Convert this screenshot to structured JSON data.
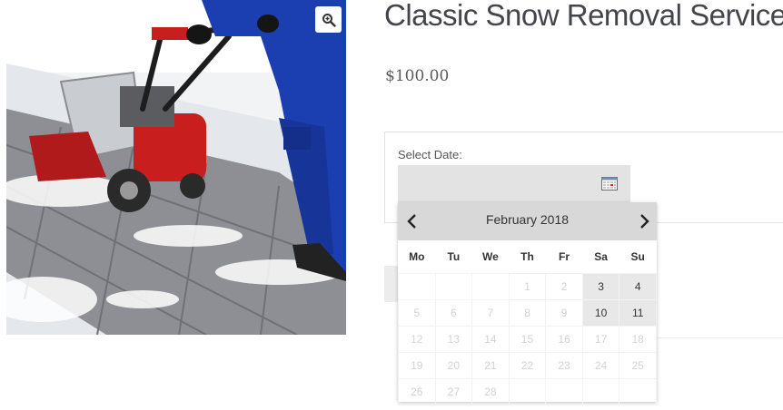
{
  "product": {
    "title": "Classic Snow Removal Service",
    "price": "$100.00"
  },
  "image": {
    "zoom_icon": "magnifier-plus-icon",
    "description_icon": "snow-blower-photo"
  },
  "booking": {
    "date_label": "Select Date:",
    "date_value": "",
    "calendar_icon": "calendar-icon"
  },
  "datepicker": {
    "month_label": "February 2018",
    "prev_icon": "chevron-left-icon",
    "next_icon": "chevron-right-icon",
    "weekdays": [
      "Mo",
      "Tu",
      "We",
      "Th",
      "Fr",
      "Sa",
      "Su"
    ],
    "weeks": [
      [
        {
          "day": "",
          "state": "empty"
        },
        {
          "day": "",
          "state": "empty"
        },
        {
          "day": "",
          "state": "empty"
        },
        {
          "day": "1",
          "state": "disabled"
        },
        {
          "day": "2",
          "state": "disabled"
        },
        {
          "day": "3",
          "state": "available"
        },
        {
          "day": "4",
          "state": "available"
        }
      ],
      [
        {
          "day": "5",
          "state": "disabled"
        },
        {
          "day": "6",
          "state": "disabled"
        },
        {
          "day": "7",
          "state": "disabled"
        },
        {
          "day": "8",
          "state": "disabled"
        },
        {
          "day": "9",
          "state": "disabled"
        },
        {
          "day": "10",
          "state": "available"
        },
        {
          "day": "11",
          "state": "available"
        }
      ],
      [
        {
          "day": "12",
          "state": "disabled"
        },
        {
          "day": "13",
          "state": "disabled"
        },
        {
          "day": "14",
          "state": "disabled"
        },
        {
          "day": "15",
          "state": "disabled"
        },
        {
          "day": "16",
          "state": "disabled"
        },
        {
          "day": "17",
          "state": "disabled"
        },
        {
          "day": "18",
          "state": "disabled"
        }
      ],
      [
        {
          "day": "19",
          "state": "disabled"
        },
        {
          "day": "20",
          "state": "disabled"
        },
        {
          "day": "21",
          "state": "disabled"
        },
        {
          "day": "22",
          "state": "disabled"
        },
        {
          "day": "23",
          "state": "disabled"
        },
        {
          "day": "24",
          "state": "disabled"
        },
        {
          "day": "25",
          "state": "disabled"
        }
      ],
      [
        {
          "day": "26",
          "state": "disabled"
        },
        {
          "day": "27",
          "state": "disabled"
        },
        {
          "day": "28",
          "state": "disabled"
        },
        {
          "day": "",
          "state": "empty"
        },
        {
          "day": "",
          "state": "empty"
        },
        {
          "day": "",
          "state": "empty"
        },
        {
          "day": "",
          "state": "empty"
        }
      ]
    ]
  },
  "colors": {
    "header_bg": "#d8d8d8",
    "available_bg": "#e8e8e8",
    "jacket_blue": "#1b3fb0",
    "blower_red": "#c81e1e"
  }
}
